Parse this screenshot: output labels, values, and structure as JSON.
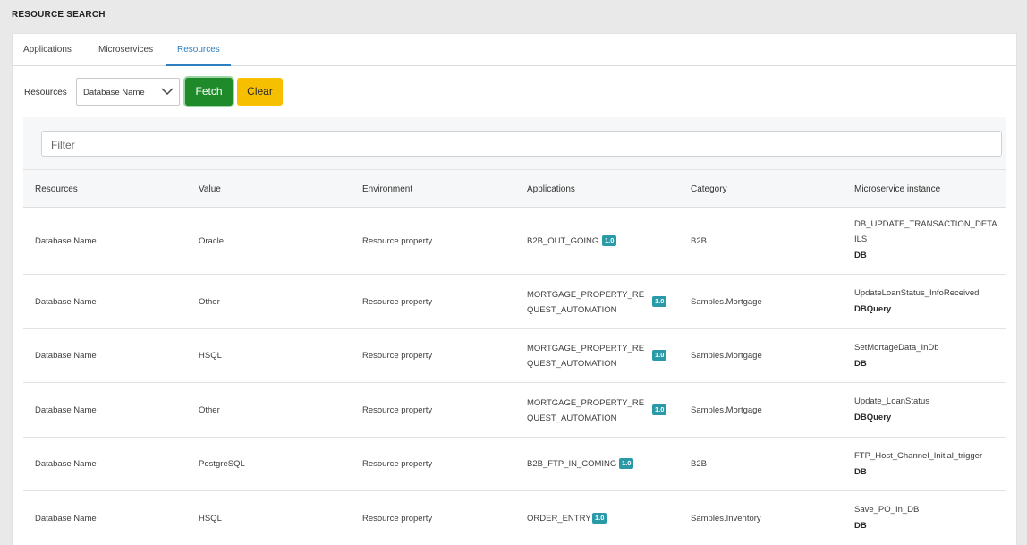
{
  "page": {
    "title": "RESOURCE SEARCH"
  },
  "tabs": [
    {
      "label": "Applications"
    },
    {
      "label": "Microservices"
    },
    {
      "label": "Resources"
    }
  ],
  "toolbar": {
    "resources_label": "Resources",
    "select_value": "Database Name",
    "fetch_label": "Fetch",
    "clear_label": "Clear"
  },
  "filter": {
    "placeholder": "Filter"
  },
  "colors": {
    "accent": "#2d7fc1",
    "fetch": "#1e8a2a",
    "clear": "#f6c000",
    "badge": "#2b9aa8"
  },
  "table": {
    "headers": [
      "Resources",
      "Value",
      "Environment",
      "Applications",
      "Category",
      "Microservice instance"
    ],
    "rows": [
      {
        "resource": "Database Name",
        "value": "Oracle",
        "environment": "Resource property",
        "application": "B2B_OUT_GOING",
        "version": "1.0",
        "category": "B2B",
        "ms_name": "DB_UPDATE_TRANSACTION_DETAILS",
        "ms_type": "DB"
      },
      {
        "resource": "Database Name",
        "value": "Other",
        "environment": "Resource property",
        "application": "MORTGAGE_PROPERTY_REQUEST_AUTOMATION",
        "version": "1.0",
        "category": "Samples.Mortgage",
        "ms_name": "UpdateLoanStatus_InfoReceived",
        "ms_type": "DBQuery"
      },
      {
        "resource": "Database Name",
        "value": "HSQL",
        "environment": "Resource property",
        "application": "MORTGAGE_PROPERTY_REQUEST_AUTOMATION",
        "version": "1.0",
        "category": "Samples.Mortgage",
        "ms_name": "SetMortageData_InDb",
        "ms_type": "DB"
      },
      {
        "resource": "Database Name",
        "value": "Other",
        "environment": "Resource property",
        "application": "MORTGAGE_PROPERTY_REQUEST_AUTOMATION",
        "version": "1.0",
        "category": "Samples.Mortgage",
        "ms_name": "Update_LoanStatus",
        "ms_type": "DBQuery"
      },
      {
        "resource": "Database Name",
        "value": "PostgreSQL",
        "environment": "Resource property",
        "application": "B2B_FTP_IN_COMING",
        "version": "1.0",
        "category": "B2B",
        "ms_name": "FTP_Host_Channel_Initial_trigger",
        "ms_type": "DB"
      },
      {
        "resource": "Database Name",
        "value": "HSQL",
        "environment": "Resource property",
        "application": "ORDER_ENTRY",
        "version": "1.0",
        "category": "Samples.Inventory",
        "ms_name": "Save_PO_In_DB",
        "ms_type": "DB"
      }
    ]
  }
}
